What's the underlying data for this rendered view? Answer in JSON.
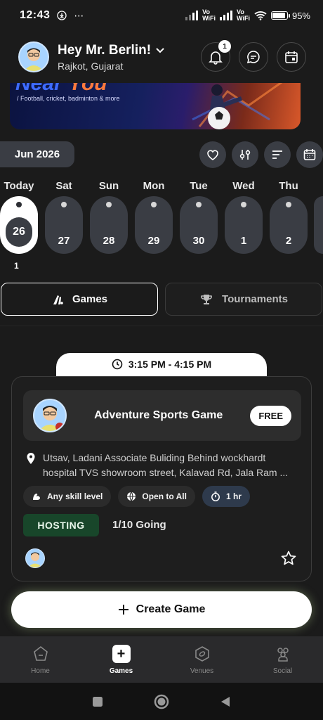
{
  "status_bar": {
    "time": "12:43",
    "extra": "⋯",
    "vowifi_1": "Vo\nWiFi",
    "vowifi_2": "Vo\nWiFi",
    "battery": "95%"
  },
  "header": {
    "greeting": "Hey Mr. Berlin!",
    "location": "Rajkot, Gujarat",
    "notification_count": "1"
  },
  "banner": {
    "title_part1": "Near",
    "title_part2": "You",
    "subtitle": "/ Football, cricket, badminton & more"
  },
  "filters": {
    "month": "Jun 2026"
  },
  "dates": [
    {
      "day": "Today",
      "date": "26",
      "active": true
    },
    {
      "day": "Sat",
      "date": "27"
    },
    {
      "day": "Sun",
      "date": "28"
    },
    {
      "day": "Mon",
      "date": "29"
    },
    {
      "day": "Tue",
      "date": "30"
    },
    {
      "day": "Wed",
      "date": "1"
    },
    {
      "day": "Thu",
      "date": "2"
    }
  ],
  "today_game_count": "1",
  "tabs": {
    "games": "Games",
    "tournaments": "Tournaments"
  },
  "game": {
    "time": "3:15 PM - 4:15 PM",
    "title": "Adventure Sports Game",
    "price": "FREE",
    "address_line1": "Utsav, Ladani Associate Buliding Behind wockhardt",
    "address_line2": "hospital TVS showroom street, Kalavad Rd, Jala Ram ...",
    "chips": {
      "skill": "Any skill level",
      "access": "Open to All",
      "duration": "1 hr"
    },
    "status": "HOSTING",
    "going": "1/10 Going"
  },
  "create_button": "Create Game",
  "bottom_nav": {
    "home": "Home",
    "games": "Games",
    "venues": "Venues",
    "social": "Social"
  },
  "colors": {
    "background": "#1b1b1b",
    "chip": "#3a3d44",
    "hosting_bg": "#18462a",
    "accent_white": "#ffffff"
  }
}
